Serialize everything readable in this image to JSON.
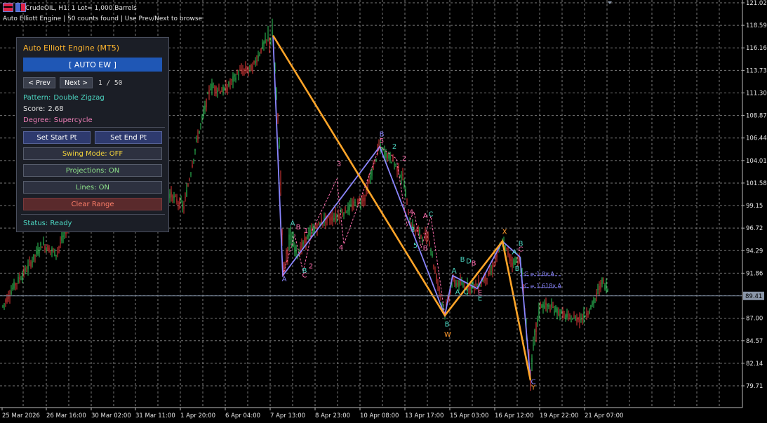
{
  "header": {
    "line1": "CrudeOIL, H1:  1 Lot= 1,000 Barrels",
    "line2": "Auto Elliott Engine | 50 counts found | Use Prev/Next to browse"
  },
  "panel": {
    "title": "Auto Elliott Engine (MT5)",
    "auto_label": "[ AUTO EW ]",
    "prev_label": "< Prev",
    "next_label": "Next >",
    "counter": "1 / 50",
    "pattern_key": "Pattern:",
    "pattern_val": "Double Zigzag",
    "score_key": "Score:",
    "score_val": "2.68",
    "degree_key": "Degree:",
    "degree_val": "Supercycle",
    "set_start": "Set Start Pt",
    "set_end": "Set End Pt",
    "swing_mode": "Swing Mode: OFF",
    "projections": "Projections: ON",
    "lines": "Lines: ON",
    "clear_range": "Clear Range",
    "status_key": "Status:",
    "status_val": "Ready"
  },
  "price_axis": {
    "labels": [
      "121.02",
      "118.59",
      "116.16",
      "113.73",
      "111.30",
      "108.87",
      "106.44",
      "104.01",
      "101.58",
      "99.15",
      "96.72",
      "94.29",
      "91.86",
      "87.00",
      "84.57",
      "82.14",
      "79.71"
    ],
    "current_price": "89.41"
  },
  "time_axis": {
    "labels": [
      "25 Mar 2026",
      "26 Mar 16:00",
      "30 Mar 02:00",
      "31 Mar 11:00",
      "1 Apr 20:00",
      "6 Apr 04:00",
      "7 Apr 13:00",
      "8 Apr 23:00",
      "10 Apr 08:00",
      "13 Apr 17:00",
      "15 Apr 03:00",
      "16 Apr 12:00",
      "19 Apr 22:00",
      "21 Apr 07:00"
    ]
  },
  "wave_labels": [
    {
      "text": "A",
      "price": 91.0,
      "t": 405,
      "color": "#8b86ff"
    },
    {
      "text": "A",
      "price": 97.0,
      "t": 417,
      "color": "#4dd9c4"
    },
    {
      "text": "B",
      "price": 96.6,
      "t": 425,
      "color": "#ff6fb0"
    },
    {
      "text": "1",
      "price": 96.2,
      "t": 436,
      "color": "#ff6fb0"
    },
    {
      "text": "2",
      "price": 92.4,
      "t": 443,
      "color": "#ff6fb0"
    },
    {
      "text": "B",
      "price": 91.9,
      "t": 434,
      "color": "#4dd9c4"
    },
    {
      "text": "C",
      "price": 91.4,
      "t": 434,
      "color": "#ff6fb0"
    },
    {
      "text": "3",
      "price": 103.4,
      "t": 483,
      "color": "#ff6fb0"
    },
    {
      "text": "4",
      "price": 94.4,
      "t": 486,
      "color": "#ff6fb0"
    },
    {
      "text": "B",
      "price": 106.6,
      "t": 544,
      "color": "#8b86ff"
    },
    {
      "text": "5",
      "price": 105.9,
      "t": 544,
      "color": "#ff6fb0"
    },
    {
      "text": "2",
      "price": 105.3,
      "t": 562,
      "color": "#4dd9c4"
    },
    {
      "text": "2",
      "price": 104.0,
      "t": 576,
      "color": "#ff6fb0"
    },
    {
      "text": "4",
      "price": 98.2,
      "t": 586,
      "color": "#ff6fb0"
    },
    {
      "text": "A",
      "price": 97.8,
      "t": 606,
      "color": "#ff6fb0"
    },
    {
      "text": "C",
      "price": 98.0,
      "t": 614,
      "color": "#4dd9c4"
    },
    {
      "text": "3",
      "price": 96.3,
      "t": 588,
      "color": "#4dd9c4"
    },
    {
      "text": "5",
      "price": 94.6,
      "t": 592,
      "color": "#4dd9c4"
    },
    {
      "text": "B",
      "price": 94.3,
      "t": 606,
      "color": "#ff6fb0"
    },
    {
      "text": "B",
      "price": 86.1,
      "t": 637,
      "color": "#4dd9c4"
    },
    {
      "text": "W",
      "price": 85.0,
      "t": 638,
      "color": "#ff9a2e"
    },
    {
      "text": "B",
      "price": 93.1,
      "t": 659,
      "color": "#4dd9c4"
    },
    {
      "text": "D",
      "price": 92.9,
      "t": 668,
      "color": "#4dd9c4"
    },
    {
      "text": "B",
      "price": 92.7,
      "t": 675,
      "color": "#ff6fb0"
    },
    {
      "text": "A",
      "price": 91.9,
      "t": 647,
      "color": "#4dd9c4"
    },
    {
      "text": "A",
      "price": 89.6,
      "t": 652,
      "color": "#4dd9c4"
    },
    {
      "text": "C",
      "price": 89.6,
      "t": 664,
      "color": "#4dd9c4"
    },
    {
      "text": "E",
      "price": 89.5,
      "t": 684,
      "color": "#ff6fb0"
    },
    {
      "text": "E",
      "price": 88.9,
      "t": 684,
      "color": "#4dd9c4"
    },
    {
      "text": "X",
      "price": 96.1,
      "t": 719,
      "color": "#ff9a2e"
    },
    {
      "text": "A",
      "price": 93.9,
      "t": 733,
      "color": "#4dd9c4"
    },
    {
      "text": "B",
      "price": 94.8,
      "t": 742,
      "color": "#4dd9c4"
    },
    {
      "text": "C",
      "price": 94.2,
      "t": 742,
      "color": "#ff6fb0"
    },
    {
      "text": "B",
      "price": 92.1,
      "t": 737,
      "color": "#4dd9c4"
    },
    {
      "text": "C",
      "price": 79.9,
      "t": 760,
      "color": "#8b86ff"
    },
    {
      "text": "Y",
      "price": 79.3,
      "t": 760,
      "color": "#ff9a2e"
    }
  ],
  "projection_notes": [
    {
      "text": "C = 1.0x A",
      "price": 91.6,
      "t": 747,
      "color": "#8b86ff"
    },
    {
      "text": "C = 1.618x A",
      "price": 90.3,
      "t": 747,
      "color": "#8b86ff"
    }
  ],
  "colors": {
    "bull": "#2fc85a",
    "bear": "#e23a3a",
    "grid": "#7a7a7a",
    "wave_main": "#ffa529",
    "wave_sub": "#8b86ff",
    "panel_bg": "#1b1e26",
    "accent_blue": "#1f57b5"
  },
  "icons": [
    "symbol-icon",
    "window-icon",
    "scroll-indicator-icon"
  ]
}
